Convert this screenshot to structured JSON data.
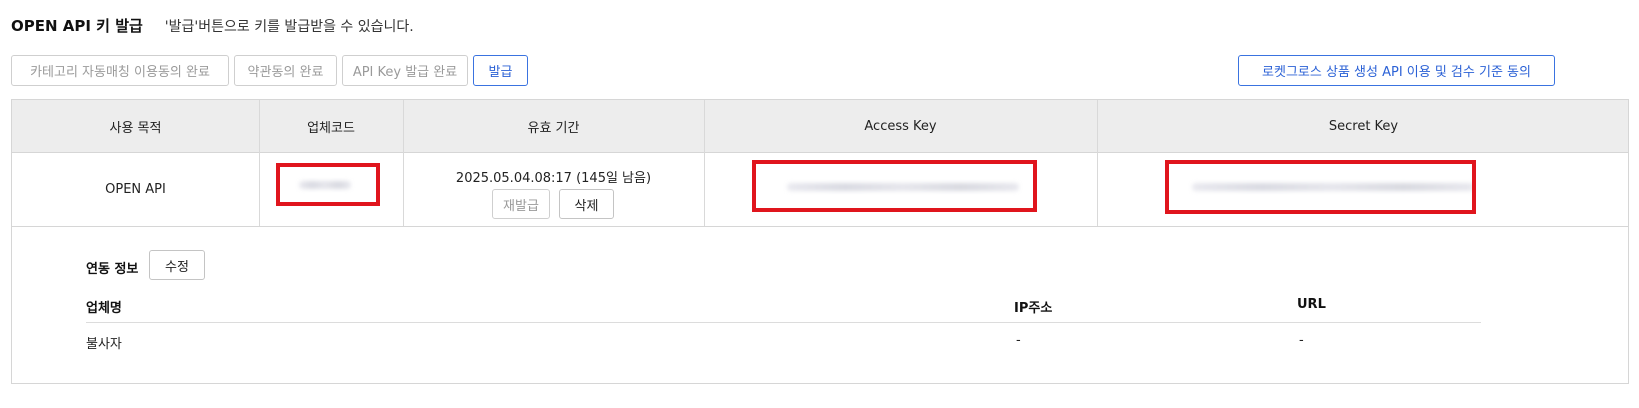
{
  "header": {
    "title": "OPEN API 키 발급",
    "description": "'발급'버튼으로 키를 발급받을 수 있습니다."
  },
  "toolbar": {
    "category_label": "카테고리 자동매칭 이용동의 완료",
    "terms_label": "약관동의 완료",
    "api_key_label": "API Key 발급 완료",
    "issue_label": "발급",
    "rocket_label": "로켓그로스 상품 생성 API 이용 및 검수 기준 동의"
  },
  "table": {
    "columns": [
      "사용 목적",
      "업체코드",
      "유효 기간",
      "Access Key",
      "Secret Key"
    ],
    "row": {
      "purpose": "OPEN API",
      "validity": "2025.05.04.08:17 (145일 남음)",
      "reissue_label": "재발급",
      "delete_label": "삭제"
    }
  },
  "integration": {
    "label": "연동 정보",
    "edit_label": "수정",
    "columns": [
      "업체명",
      "IP주소",
      "URL"
    ],
    "values": [
      "불사자",
      "-",
      "-"
    ]
  },
  "colors": {
    "accent": "#2c62d6",
    "highlight": "#e0151d"
  }
}
